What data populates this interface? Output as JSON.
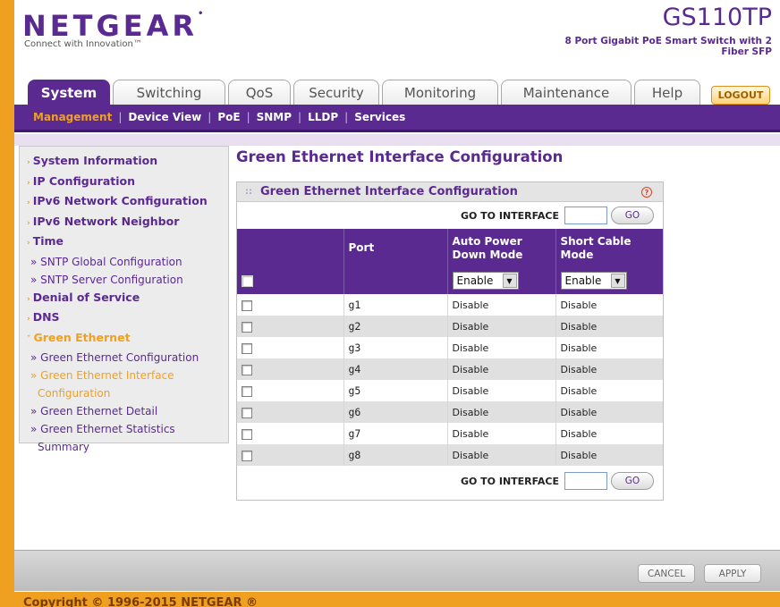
{
  "header": {
    "logo": "NETGEAR",
    "tagline": "Connect with Innovation™",
    "model": "GS110TP",
    "model_sub": "8 Port Gigabit PoE Smart Switch with 2 Fiber SFP"
  },
  "tabs": [
    {
      "label": "System"
    },
    {
      "label": "Switching"
    },
    {
      "label": "QoS"
    },
    {
      "label": "Security"
    },
    {
      "label": "Monitoring"
    },
    {
      "label": "Maintenance"
    },
    {
      "label": "Help"
    }
  ],
  "logout_label": "LOGOUT",
  "subnav": [
    {
      "label": "Management"
    },
    {
      "label": "Device View"
    },
    {
      "label": "PoE"
    },
    {
      "label": "SNMP"
    },
    {
      "label": "LLDP"
    },
    {
      "label": "Services"
    }
  ],
  "sidebar": {
    "items": [
      {
        "label": "System Information"
      },
      {
        "label": "IP Configuration"
      },
      {
        "label": "IPv6 Network Configuration"
      },
      {
        "label": "IPv6 Network Neighbor"
      },
      {
        "label": "Time"
      },
      {
        "label": "» SNTP Global Configuration"
      },
      {
        "label": "» SNTP Server Configuration"
      },
      {
        "label": "Denial of Service"
      },
      {
        "label": "DNS"
      },
      {
        "label": "Green Ethernet"
      },
      {
        "label": "» Green Ethernet Configuration"
      },
      {
        "label": "» Green Ethernet Interface"
      },
      {
        "label": "Configuration"
      },
      {
        "label": "» Green Ethernet Detail"
      },
      {
        "label": "» Green Ethernet Statistics"
      },
      {
        "label": "Summary"
      }
    ]
  },
  "main": {
    "title": "Green Ethernet Interface Configuration",
    "panel_title": "Green Ethernet Interface Configuration",
    "help_icon": "?",
    "goto_label": "GO TO INTERFACE",
    "go_label": "GO",
    "columns": [
      "Port",
      "Auto Power Down Mode",
      "Short Cable Mode"
    ],
    "col_auto_line1": "Auto Power",
    "col_auto_line2": "Down Mode",
    "col_short_line1": "Short Cable",
    "col_short_line2": "Mode",
    "ctrl_auto": "Enable",
    "ctrl_short": "Enable",
    "rows": [
      {
        "port": "g1",
        "auto": "Disable",
        "short": "Disable"
      },
      {
        "port": "g2",
        "auto": "Disable",
        "short": "Disable"
      },
      {
        "port": "g3",
        "auto": "Disable",
        "short": "Disable"
      },
      {
        "port": "g4",
        "auto": "Disable",
        "short": "Disable"
      },
      {
        "port": "g5",
        "auto": "Disable",
        "short": "Disable"
      },
      {
        "port": "g6",
        "auto": "Disable",
        "short": "Disable"
      },
      {
        "port": "g7",
        "auto": "Disable",
        "short": "Disable"
      },
      {
        "port": "g8",
        "auto": "Disable",
        "short": "Disable"
      }
    ]
  },
  "footer": {
    "cancel_label": "CANCEL",
    "apply_label": "APPLY",
    "copyright": "Copyright © 1996-2015 NETGEAR ®"
  }
}
